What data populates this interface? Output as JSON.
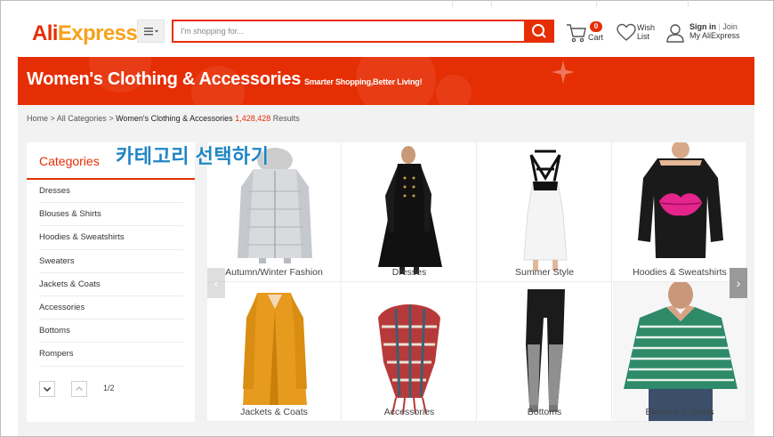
{
  "header": {
    "logo_part1": "Ali",
    "logo_part2": "Express",
    "logo_tm": "™",
    "menu_icon": "hamburger-menu-icon",
    "search_placeholder": "I'm shopping for...",
    "search_icon": "search-icon",
    "cart_count": "0",
    "cart_label": "Cart",
    "wish_line1": "Wish",
    "wish_line2": "List",
    "sign_in": "Sign in",
    "join_separator": "|",
    "join": "Join",
    "my_account": "My AliExpress"
  },
  "banner": {
    "title": "Women's Clothing & Accessories",
    "subtitle": "Smarter Shopping,Better Living!",
    "color": "#e62e04"
  },
  "breadcrumb": {
    "home": "Home",
    "sep1": " > ",
    "all": "All Categories",
    "sep2": " > ",
    "current": "Women's Clothing & Accessories",
    "count": "1,428,428",
    "results": " Results"
  },
  "sidebar": {
    "title": "Categories",
    "items": [
      "Dresses",
      "Blouses & Shirts",
      "Hoodies & Sweatshirts",
      "Sweaters",
      "Jackets & Coats",
      "Accessories",
      "Bottoms",
      "Rompers"
    ],
    "pager": {
      "down_icon": "chevron-down-icon",
      "up_icon": "chevron-up-icon",
      "page": "1/2"
    }
  },
  "annotation": "카테고리 선택하기",
  "tiles": [
    {
      "label": "Autumn/Winter Fashion",
      "icon": "puffer-jacket-image"
    },
    {
      "label": "Dresses",
      "icon": "black-coat-dress-image"
    },
    {
      "label": "Summer Style",
      "icon": "white-halter-dress-image"
    },
    {
      "label": "Hoodies & Sweatshirts",
      "icon": "lips-sweatshirt-image"
    },
    {
      "label": "Jackets & Coats",
      "icon": "yellow-coat-image"
    },
    {
      "label": "Accessories",
      "icon": "plaid-scarf-image"
    },
    {
      "label": "Bottoms",
      "icon": "leggings-image"
    },
    {
      "label": "Blouses & Shirts",
      "icon": "striped-shirt-image"
    }
  ],
  "carousel": {
    "prev": "‹",
    "next": "›"
  }
}
